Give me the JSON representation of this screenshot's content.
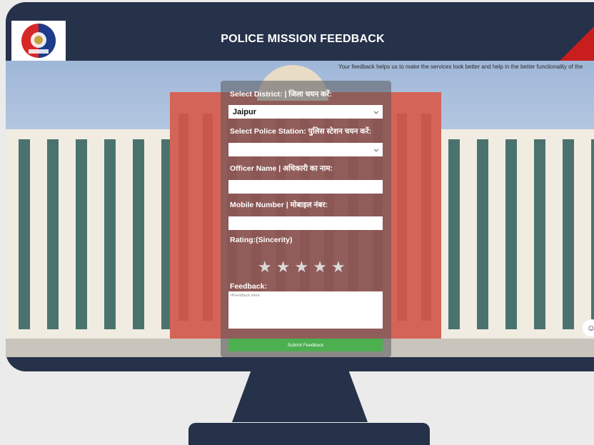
{
  "app": {
    "title": "POLICE MISSION FEEDBACK",
    "tagline": "Your feedback helps us to make the services look better and help in the better functionality of the"
  },
  "form": {
    "district": {
      "label": "Select District: | जिला चयन करें:",
      "value": "Jaipur"
    },
    "police_station": {
      "label": "Select Police Station: पुलिस स्टेशन चयन करें:",
      "value": ""
    },
    "officer_name": {
      "label": "Officer Name | अधिकारी का नाम:",
      "value": ""
    },
    "mobile_number": {
      "label": "Mobile Number | मोबाइल नंबर:",
      "value": ""
    },
    "rating": {
      "label": "Rating:(Sincerity)",
      "stars_total": 5,
      "stars_selected": 0
    },
    "feedback": {
      "label": "Feedback:",
      "placeholder": "#Feedback Here"
    },
    "submit_label": "Submit Feedback"
  },
  "colors": {
    "header_bg": "#26314a",
    "accent_red": "#c81e1e",
    "submit_green": "#4caf50"
  },
  "icons": {
    "dropdown": "chevron-down-icon",
    "star": "star-icon",
    "chat": "chat-icon",
    "logo": "police-emblem-logo"
  }
}
